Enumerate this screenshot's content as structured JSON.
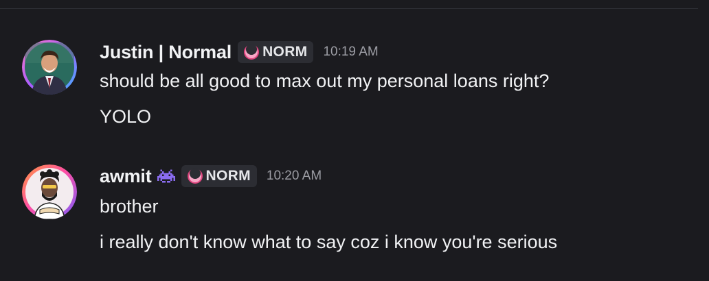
{
  "messages": [
    {
      "username": "Justin | Normal",
      "tag": "NORM",
      "timestamp": "10:19 AM",
      "lines": [
        "should be all good to max out my personal loans right?",
        "YOLO"
      ]
    },
    {
      "username": "awmit",
      "tag": "NORM",
      "timestamp": "10:20 AM",
      "lines": [
        "brother",
        "i really don't know what to say coz i know you're serious"
      ]
    }
  ],
  "colors": {
    "background": "#1b1b1f",
    "text": "#f1f2f4",
    "timestamp": "#9c9da4",
    "tag_background": "#2c2d33",
    "tag_icon": "#e0467f"
  },
  "icons": {
    "tag_icon": "pink-crescent-icon",
    "username_badge": "purple-space-invader-icon"
  }
}
